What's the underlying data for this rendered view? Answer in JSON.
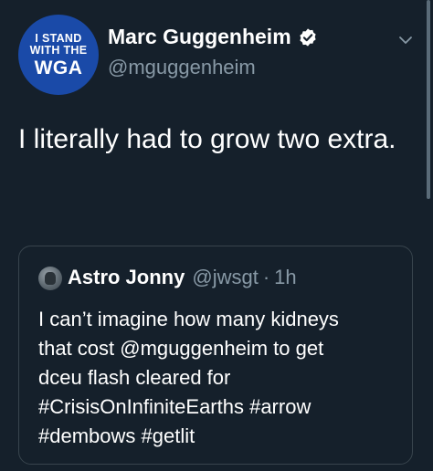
{
  "tweet": {
    "avatar": {
      "line1": "I STAND",
      "line2": "WITH THE",
      "line3": "WGA",
      "bg_color": "#1a4aa8"
    },
    "display_name": "Marc Guggenheim",
    "handle": "@mguggenheim",
    "verified": true,
    "text": "I literally had to grow two extra.",
    "menu_icon": "chevron-down-icon"
  },
  "quoted_tweet": {
    "display_name": "Astro Jonny",
    "handle": "@jwsgt",
    "separator": "·",
    "time": "1h",
    "lines": [
      "I can’t imagine how many kidneys",
      "that cost  @mguggenheim  to get",
      "dceu flash cleared for",
      "#CrisisOnInfiniteEarths #arrow",
      "#dembows #getlit"
    ]
  },
  "colors": {
    "background": "#15202b",
    "text_primary": "#ffffff",
    "text_secondary": "#8899a6",
    "border": "#38444d"
  }
}
